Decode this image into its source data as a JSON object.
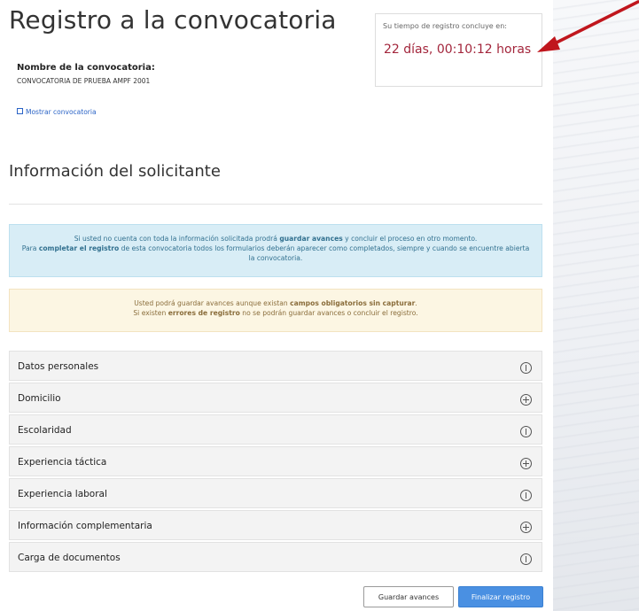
{
  "header": {
    "title": "Registro a la convocatoria"
  },
  "timer": {
    "label": "Su tiempo de registro concluye en:",
    "value": "22 días, 00:10:12 horas",
    "value_color": "#a3263c"
  },
  "convocatoria": {
    "label": "Nombre de la convocatoria:",
    "name": "CONVOCATORIA DE PRUEBA AMPF 2001",
    "show_link": "Mostrar convocatoria"
  },
  "section": {
    "title": "Información del solicitante"
  },
  "alerts": {
    "info": {
      "p1": "Si usted no cuenta con toda la información solicitada prodrá ",
      "b1": "guardar avances",
      "p2": " y concluir el proceso en otro momento.",
      "p3": "Para ",
      "b2": "completar el registro",
      "p4": " de esta convocatoria todos los formularios deberán aparecer como completados, siempre y cuando se encuentre abierta la convocatoria."
    },
    "warning": {
      "p1": "Usted podrá guardar avances aunque existan ",
      "b1": "campos obligatorios sin capturar",
      "p2": ".",
      "p3": "Si existen ",
      "b2": "errores de registro",
      "p4": " no se podrán guardar avances o concluir el registro."
    }
  },
  "accordion": [
    {
      "label": "Datos personales",
      "icon": "info-circle-icon"
    },
    {
      "label": "Domicilio",
      "icon": "plus-circle-icon"
    },
    {
      "label": "Escolaridad",
      "icon": "info-circle-icon"
    },
    {
      "label": "Experiencia táctica",
      "icon": "plus-circle-icon"
    },
    {
      "label": "Experiencia laboral",
      "icon": "info-circle-icon"
    },
    {
      "label": "Información complementaria",
      "icon": "plus-circle-icon"
    },
    {
      "label": "Carga de documentos",
      "icon": "info-circle-icon"
    }
  ],
  "buttons": {
    "save": "Guardar avances",
    "finish": "Finalizar registro"
  },
  "colors": {
    "primary": "#4a90e2",
    "arrow": "#c0161d",
    "info_bg": "#d8edf6",
    "warning_bg": "#fcf6e3"
  }
}
